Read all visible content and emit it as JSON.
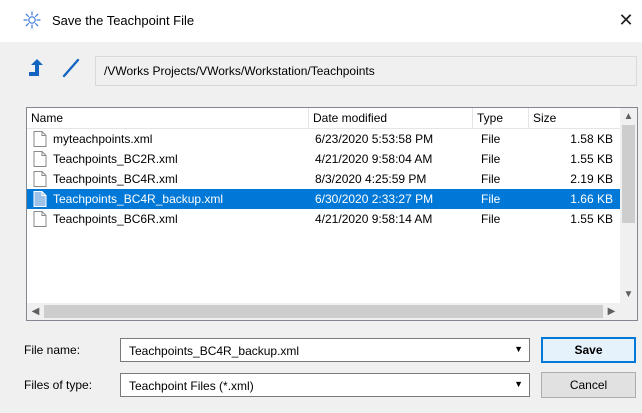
{
  "window": {
    "title": "Save the Teachpoint File",
    "close_glyph": "✕",
    "title_icon": "sun-icon"
  },
  "toolbar": {
    "up_icon": "up-arrow-icon",
    "pen_icon": "slash-pen-icon",
    "path": "/VWorks Projects/VWorks/Workstation/Teachpoints"
  },
  "filelist": {
    "columns": [
      "Name",
      "Date modified",
      "Type",
      "Size"
    ],
    "rows": [
      {
        "name": "myteachpoints.xml",
        "date": "6/23/2020 5:53:58 PM",
        "type": "File",
        "size": "1.58 KB",
        "selected": false
      },
      {
        "name": "Teachpoints_BC2R.xml",
        "date": "4/21/2020 9:58:04 AM",
        "type": "File",
        "size": "1.55 KB",
        "selected": false
      },
      {
        "name": "Teachpoints_BC4R.xml",
        "date": "8/3/2020 4:25:59 PM",
        "type": "File",
        "size": "2.19 KB",
        "selected": false
      },
      {
        "name": "Teachpoints_BC4R_backup.xml",
        "date": "6/30/2020 2:33:27 PM",
        "type": "File",
        "size": "1.66 KB",
        "selected": true
      },
      {
        "name": "Teachpoints_BC6R.xml",
        "date": "4/21/2020 9:58:14 AM",
        "type": "File",
        "size": "1.55 KB",
        "selected": false
      }
    ]
  },
  "form": {
    "filename_label": "File name:",
    "filename_value": "Teachpoints_BC4R_backup.xml",
    "filetype_label": "Files of type:",
    "filetype_value": "Teachpoint Files (*.xml)",
    "save_label": "Save",
    "cancel_label": "Cancel"
  },
  "colors": {
    "selection": "#0078d7",
    "up_arrow": "#1565c0"
  }
}
